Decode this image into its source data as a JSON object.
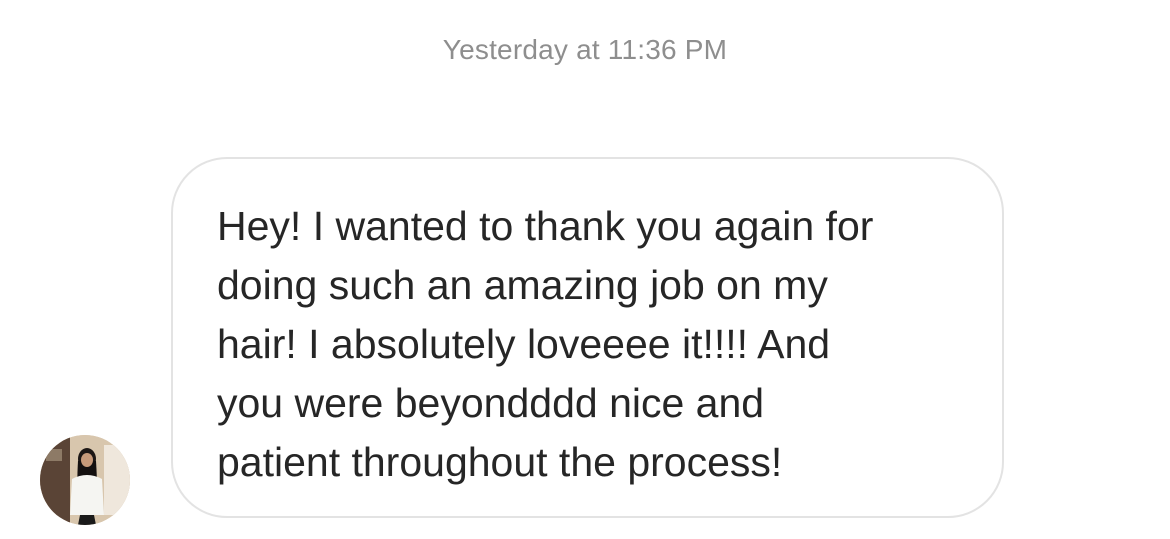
{
  "thread": {
    "timestamp": "Yesterday at 11:36 PM"
  },
  "message": {
    "direction": "incoming",
    "text": "Hey! I wanted to thank you again for\ndoing such an amazing job on my\nhair! I absolutely loveeee it!!!! And\nyou were beyondddd nice and\npatient throughout the process!",
    "bubble_border_color": "#e3e3e3",
    "text_color": "#262626"
  },
  "sender": {
    "avatar_icon": "profile-photo-avatar"
  },
  "colors": {
    "timestamp": "#8e8e8e",
    "background": "#ffffff"
  }
}
